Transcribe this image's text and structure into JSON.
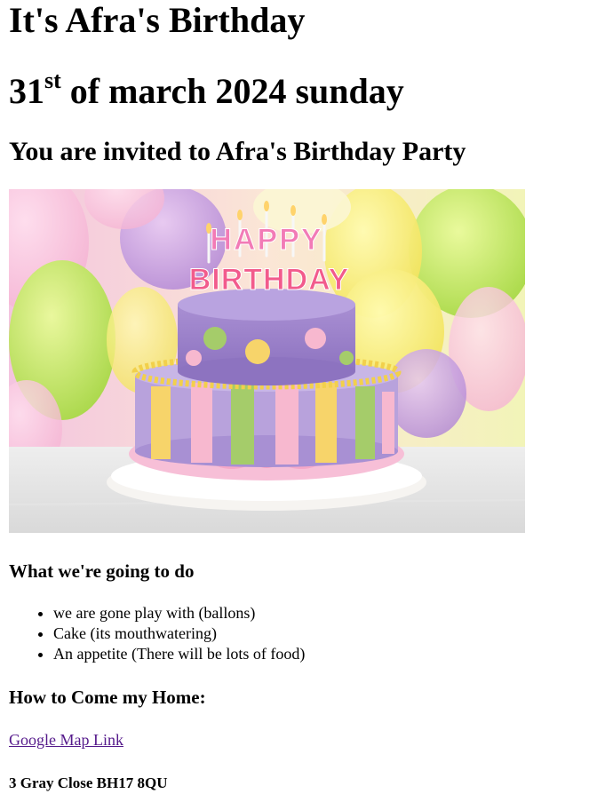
{
  "header": {
    "title": "It's Afra's Birthday",
    "date_number": "31",
    "date_suffix": "st",
    "date_rest": " of march 2024 sunday"
  },
  "invitation": "You are invited to Afra's Birthday Party",
  "hero_image": {
    "description_icon": "birthday-cake-image",
    "cake_topper_line1": "HAPPY",
    "cake_topper_line2": "BIRTHDAY"
  },
  "activities": {
    "heading": "What we're going to do",
    "items": [
      "we are gone play with (ballons)",
      "Cake (its mouthwatering)",
      "An appetite (There will be lots of food)"
    ]
  },
  "directions": {
    "heading": "How to Come my Home:",
    "map_link_label": "Google Map Link",
    "address": "3 Gray Close BH17 8QU"
  },
  "colors": {
    "link_visited": "#551a8b",
    "text": "#000000",
    "background": "#ffffff"
  }
}
